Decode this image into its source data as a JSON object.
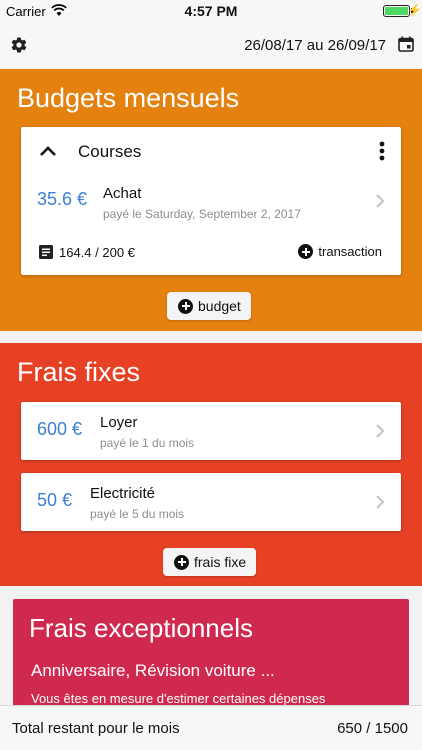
{
  "status_bar": {
    "carrier": "Carrier",
    "time": "4:57 PM"
  },
  "toolbar": {
    "date_range": "26/08/17 au 26/09/17"
  },
  "budgets": {
    "title": "Budgets mensuels",
    "card": {
      "name": "Courses",
      "transaction": {
        "amount": "35.6 €",
        "label": "Achat",
        "date": "payé le Saturday, September 2, 2017"
      },
      "progress": "164.4 / 200 €",
      "add_transaction_label": "transaction"
    },
    "add_label": "budget"
  },
  "fixed": {
    "title": "Frais fixes",
    "items": [
      {
        "amount": "600 €",
        "label": "Loyer",
        "sub": "payé le 1 du mois"
      },
      {
        "amount": "50 €",
        "label": "Electricité",
        "sub": "payé le 5 du mois"
      }
    ],
    "add_label": "frais fixe"
  },
  "exceptional": {
    "title": "Frais exceptionnels",
    "subtitle": "Anniversaire, Révision voiture ...",
    "description": "Vous êtes en mesure d'estimer certaines dépenses"
  },
  "footer": {
    "label": "Total restant pour le mois",
    "value": "650 / 1500"
  },
  "colors": {
    "budgets_bg": "#e5810e",
    "fixed_bg": "#e74125",
    "exceptional_bg": "#d0294f",
    "amount": "#3d7fd4"
  }
}
